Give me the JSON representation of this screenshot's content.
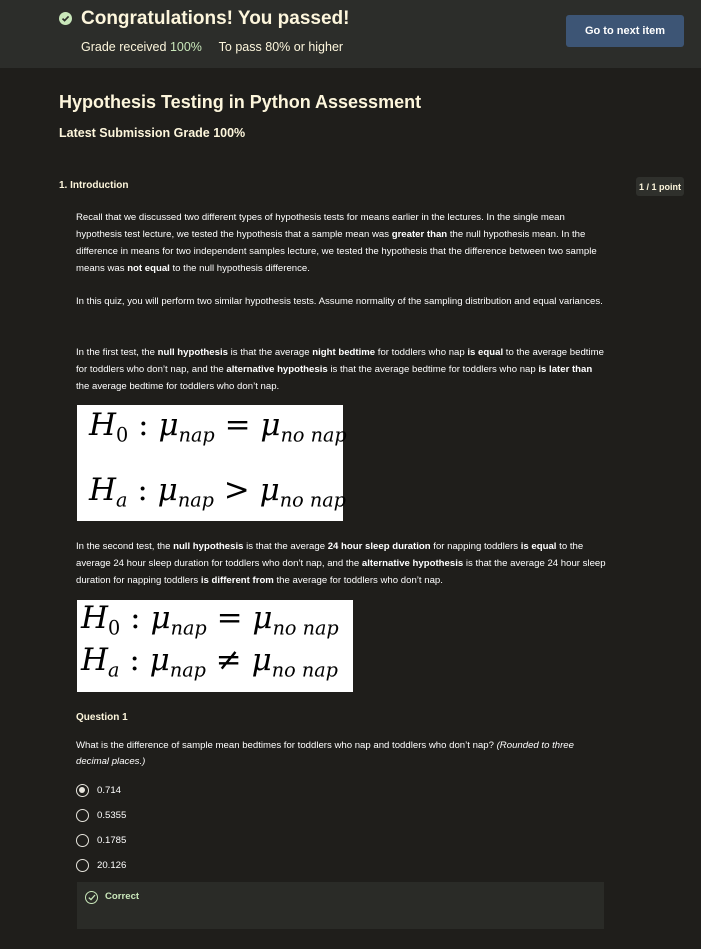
{
  "banner": {
    "title": "Congratulations! You passed!",
    "grade_received_label": "Grade received",
    "grade_received_value": "100%",
    "to_pass_label": "To pass",
    "to_pass_value": "80% or higher",
    "next_button": "Go to next item",
    "check_icon": "check-circle-icon"
  },
  "page": {
    "title": "Hypothesis Testing in Python Assessment",
    "latest_grade": "Latest Submission Grade 100%"
  },
  "item": {
    "number_title": "1.  Introduction",
    "points": "1 / 1 point",
    "para1": [
      {
        "t": "Recall that we discussed two different types of hypothesis tests for means earlier in the lectures. In the single mean hypothesis test lecture, we tested the hypothesis that a sample mean was "
      },
      {
        "b": "greater than"
      },
      {
        "t": " the null hypothesis mean. In the difference in means for two independent samples lecture, we tested the hypothesis that the difference between two sample means was "
      },
      {
        "b": "not equal"
      },
      {
        "t": " to the null hypothesis difference."
      }
    ],
    "para2": "In this quiz, you will perform two similar hypothesis tests. Assume normality of the sampling distribution and equal variances.",
    "para3": [
      {
        "t": "In the first test, the "
      },
      {
        "b": "null hypothesis"
      },
      {
        "t": " is that the average "
      },
      {
        "b": "night bedtime"
      },
      {
        "t": " for toddlers who nap "
      },
      {
        "b": "is equal"
      },
      {
        "t": " to the average bedtime for toddlers who don’t nap, and the "
      },
      {
        "b": "alternative hypothesis"
      },
      {
        "t": " is that the average bedtime for toddlers who nap "
      },
      {
        "b": "is later than"
      },
      {
        "t": " the average bedtime for toddlers who don’t nap."
      }
    ],
    "para4": [
      {
        "t": "In the second test, the "
      },
      {
        "b": "null hypothesis"
      },
      {
        "t": " is that the average "
      },
      {
        "b": "24 hour sleep duration"
      },
      {
        "t": " for napping toddlers "
      },
      {
        "b": "is equal"
      },
      {
        "t": " to the average 24 hour sleep duration for toddlers who don’t nap, and the "
      },
      {
        "b": "alternative hypothesis"
      },
      {
        "t": " is that the average 24 hour sleep duration for napping toddlers "
      },
      {
        "b": "is different from"
      },
      {
        "t": " the average for toddlers who don’t nap."
      }
    ]
  },
  "equations": {
    "eq1": {
      "h0_symbol": "H",
      "h0_sub": "0",
      "lhs": "μ",
      "lhs_sub": "nap",
      "h0_op": "=",
      "rhs": "μ",
      "rhs_sub": "no nap",
      "ha_symbol": "H",
      "ha_sub": "a",
      "ha_op": ">"
    },
    "eq2": {
      "h0_symbol": "H",
      "h0_sub": "0",
      "lhs": "μ",
      "lhs_sub": "nap",
      "h0_op": "=",
      "rhs": "μ",
      "rhs_sub": "no nap",
      "ha_symbol": "H",
      "ha_sub": "a",
      "ha_op": "≠"
    },
    "colon": ":"
  },
  "question": {
    "label": "Question 1",
    "text": "What is the difference of sample mean bedtimes for toddlers who nap and toddlers who don’t nap? ",
    "hint": "(Rounded to three decimal places.)",
    "options": [
      {
        "label": "0.714",
        "selected": true
      },
      {
        "label": "0.5355",
        "selected": false
      },
      {
        "label": "0.1785",
        "selected": false
      },
      {
        "label": "20.126",
        "selected": false
      }
    ],
    "feedback": "Correct",
    "feedback_icon": "check-circle-outline-icon"
  },
  "colors": {
    "background": "#1f1e1b",
    "banner": "#2c2d2a",
    "button": "#3d5575",
    "success": "#c9e7ba",
    "heading_text": "#fdf6dc"
  }
}
